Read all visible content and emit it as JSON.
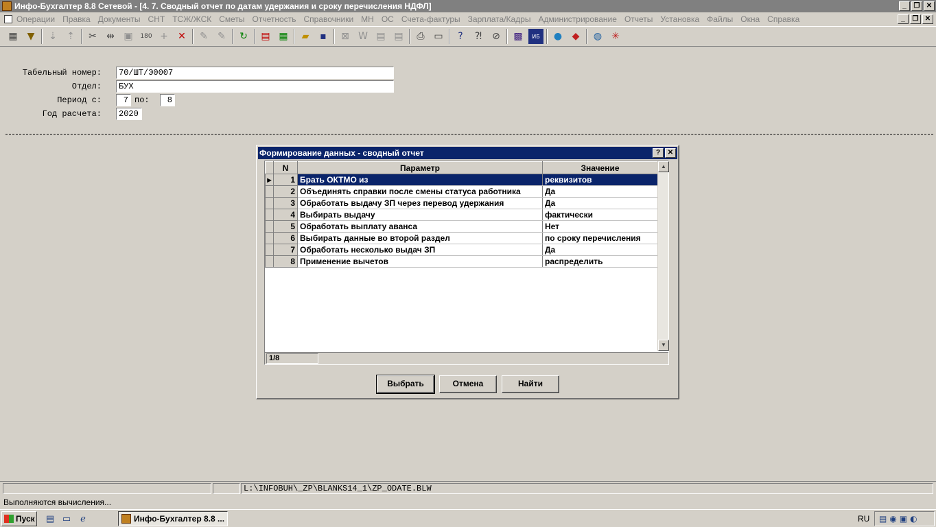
{
  "window": {
    "title": "Инфо-Бухгалтер 8.8 Сетевой - [4. 7. Сводный отчет по датам удержания и сроку перечисления НДФЛ]",
    "min": "_",
    "restore": "❐",
    "close": "✕"
  },
  "menu": {
    "items": [
      "Операции",
      "Правка",
      "Документы",
      "СНТ",
      "ТСЖ/ЖСК",
      "Сметы",
      "Отчетность",
      "Справочники",
      "МН",
      "ОС",
      "Счета-фактуры",
      "Зарплата/Кадры",
      "Администрирование",
      "Отчеты",
      "Установка",
      "Файлы",
      "Окна",
      "Справка"
    ]
  },
  "toolbar": {
    "icons": [
      "table-icon",
      "filter-icon",
      "sort-asc-icon",
      "sort-desc-icon",
      "cut-icon",
      "move-icon",
      "paste-icon",
      "counter-icon",
      "add-icon",
      "delete-icon",
      "mark-icon",
      "unmark-icon",
      "refresh-icon",
      "pdf-icon",
      "excel-icon",
      "open-folder-icon",
      "save-icon",
      "box-icon",
      "word-icon",
      "page-icon",
      "page2-icon",
      "print-icon",
      "preview-icon",
      "help-icon",
      "whatsthis-icon",
      "compass-icon",
      "film-icon",
      "ib10-icon",
      "skype-icon",
      "remote-icon",
      "globe-icon",
      "network-icon"
    ]
  },
  "form": {
    "tab_label": "Табельный номер:",
    "tab_value": "70/ШТ/Э0007",
    "dept_label": "Отдел:",
    "dept_value": "БУХ",
    "period_label": "Период с:",
    "period_from": "7",
    "period_to_label": "по:",
    "period_to": "8",
    "year_label": "Год расчета:",
    "year_value": "2020"
  },
  "dialog": {
    "title": "Формирование данных - сводный отчет",
    "help": "?",
    "close": "✕",
    "columns": {
      "n": "N",
      "param": "Параметр",
      "value": "Значение"
    },
    "rows": [
      {
        "n": "1",
        "param": "Брать ОКТМО из",
        "value": "реквизитов"
      },
      {
        "n": "2",
        "param": "Объединять справки после смены статуса работника",
        "value": "Да"
      },
      {
        "n": "3",
        "param": "Обработать выдачу ЗП через перевод удержания",
        "value": "Да"
      },
      {
        "n": "4",
        "param": "Выбирать выдачу",
        "value": "фактически"
      },
      {
        "n": "5",
        "param": "Обработать выплату аванса",
        "value": "Нет"
      },
      {
        "n": "6",
        "param": "Выбирать данные во второй раздел",
        "value": "по сроку перечисления"
      },
      {
        "n": "7",
        "param": "Обработать несколько выдач ЗП",
        "value": "Да"
      },
      {
        "n": "8",
        "param": "Применение вычетов",
        "value": "распределить"
      }
    ],
    "record_counter": "1/8",
    "buttons": {
      "select": "Выбрать",
      "cancel": "Отмена",
      "find": "Найти"
    }
  },
  "statusbar": {
    "path": "L:\\INFOBUH\\_ZP\\BLANKS14_1\\ZP_ODATE.BLW",
    "message": "Выполняются вычисления..."
  },
  "taskbar": {
    "start": "Пуск",
    "task": "Инфо-Бухгалтер 8.8 ...",
    "lang": "RU"
  },
  "colors": {
    "face": "#d4d0c8",
    "selection": "#0a246a",
    "title_inactive": "#808080"
  }
}
